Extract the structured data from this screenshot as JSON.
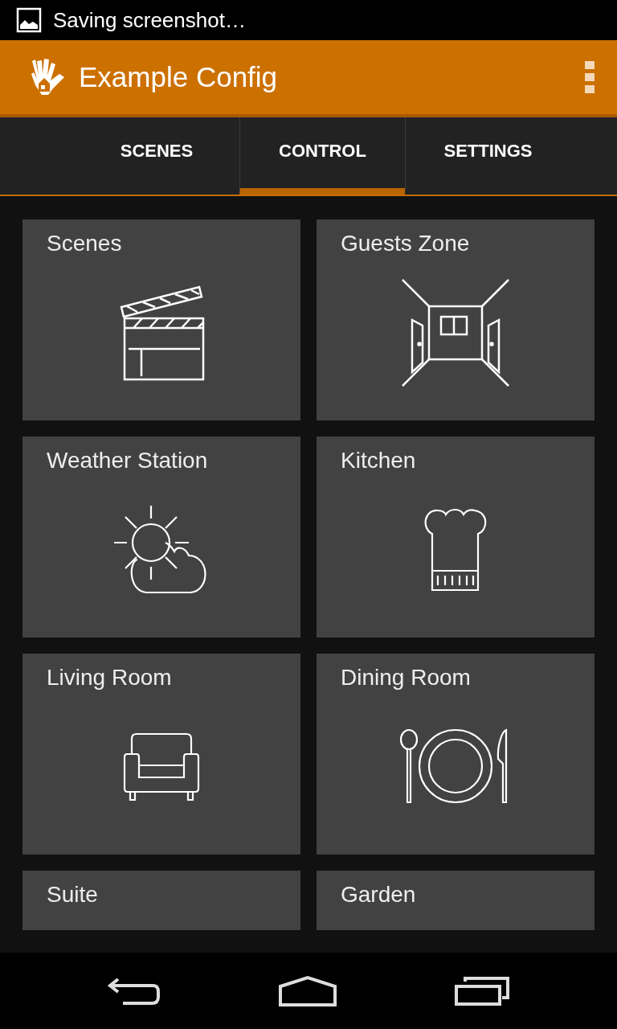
{
  "status_bar": {
    "notification": "Saving screenshot…"
  },
  "app_bar": {
    "title": "Example Config"
  },
  "tabs": [
    {
      "label": "SCENES",
      "selected": false
    },
    {
      "label": "CONTROL",
      "selected": true
    },
    {
      "label": "SETTINGS",
      "selected": false
    }
  ],
  "tiles": [
    {
      "label": "Scenes",
      "kind": "clapper"
    },
    {
      "label": "Guests Zone",
      "kind": "room"
    },
    {
      "label": "Weather Station",
      "kind": "weather"
    },
    {
      "label": "Kitchen",
      "kind": "chef-hat"
    },
    {
      "label": "Living Room",
      "kind": "armchair"
    },
    {
      "label": "Dining Room",
      "kind": "plate"
    },
    {
      "label": "Suite"
    },
    {
      "label": "Garden"
    }
  ]
}
